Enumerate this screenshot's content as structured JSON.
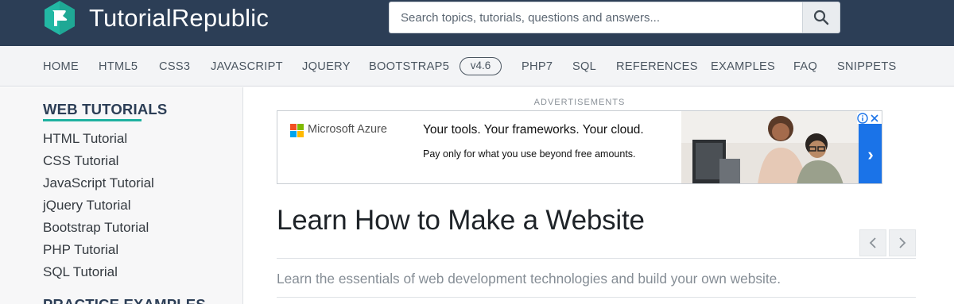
{
  "header": {
    "logo_text": "TutorialRepublic",
    "search": {
      "placeholder": "Search topics, tutorials, questions and answers...",
      "value": ""
    }
  },
  "nav": {
    "items": [
      "HOME",
      "HTML5",
      "CSS3",
      "JAVASCRIPT",
      "JQUERY",
      "BOOTSTRAP5",
      "PHP7",
      "SQL",
      "REFERENCES",
      "EXAMPLES",
      "FAQ",
      "SNIPPETS"
    ],
    "badge": "v4.6"
  },
  "sidebar": {
    "heading": "WEB TUTORIALS",
    "links": [
      "HTML Tutorial",
      "CSS Tutorial",
      "JavaScript Tutorial",
      "jQuery Tutorial",
      "Bootstrap Tutorial",
      "PHP Tutorial",
      "SQL Tutorial"
    ],
    "heading2": "PRACTICE EXAMPLES"
  },
  "ad": {
    "label": "ADVERTISEMENTS",
    "brand": "Microsoft Azure",
    "headline": "Your tools. Your frameworks. Your cloud.",
    "subline": "Pay only for what you use beyond free amounts.",
    "arrow": "›",
    "colors": {
      "arrow_bg": "#1a73e8",
      "ms_red": "#f25022",
      "ms_green": "#7fba00",
      "ms_blue": "#00a4ef",
      "ms_yellow": "#ffb900"
    }
  },
  "main": {
    "title": "Learn How to Make a Website",
    "lead": "Learn the essentials of web development technologies and build your own website."
  },
  "colors": {
    "header_bg": "#2c3e56",
    "accent": "#1eb1a0"
  }
}
